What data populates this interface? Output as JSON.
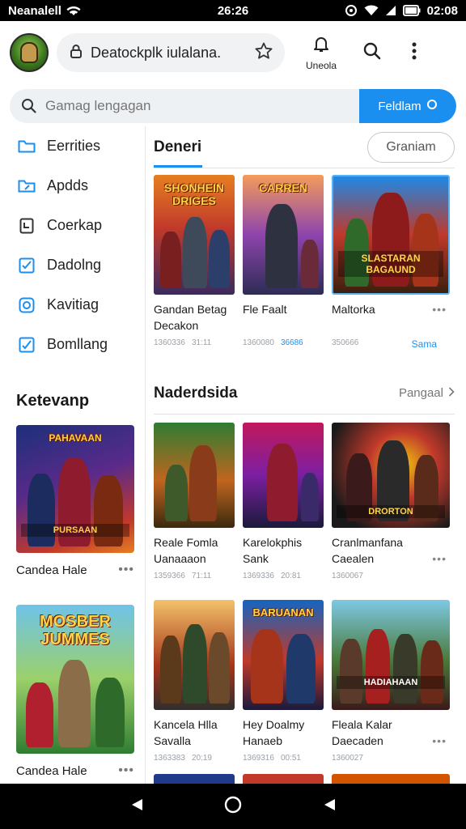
{
  "status": {
    "carrier": "Neanalell",
    "clock": "26:26",
    "time": "02:08"
  },
  "topbar": {
    "url": "Deatockplk iulalana.",
    "bell_label": "Uneola"
  },
  "search": {
    "placeholder": "Gamag lengagan",
    "button_label": "Feldlam"
  },
  "sidebar": {
    "items": [
      {
        "label": "Eerrities",
        "icon": "folder-icon"
      },
      {
        "label": "Apdds",
        "icon": "folder-edit-icon"
      },
      {
        "label": "Coerkap",
        "icon": "page-icon"
      },
      {
        "label": "Dadolng",
        "icon": "checkbox-icon"
      },
      {
        "label": "Kavitiag",
        "icon": "circle-square-icon"
      },
      {
        "label": "Bomllang",
        "icon": "check-square-icon"
      }
    ],
    "section_title": "Ketevanp",
    "cards": [
      {
        "caption": "Candea Hale",
        "art_title": "PAHAVAAN",
        "art_banner": "PURSAAN"
      },
      {
        "caption": "Candea Hale",
        "art_title": "MOSBER JUMMES",
        "art_banner": ""
      }
    ]
  },
  "main": {
    "section1": {
      "title": "Deneri",
      "action": "Graniam",
      "cards": [
        {
          "title_line1": "Gandan Betag",
          "title_line2": "Decakon",
          "meta1": "1360336",
          "meta2": "31:11",
          "art_title": "SHONHEIN DRIGES",
          "art_banner": ""
        },
        {
          "title_line1": "Fle Faalt",
          "title_line2": "",
          "meta1": "1360080",
          "meta2": "36686",
          "art_title": "CARREN",
          "art_banner": ""
        },
        {
          "title_line1": "Maltorka",
          "title_line2": "",
          "meta1": "350666",
          "meta2": "Sama",
          "art_title": "",
          "art_banner": "SLASTARAN BAGAUND"
        }
      ]
    },
    "section2": {
      "title": "Naderdsida",
      "action": "Pangaal",
      "rows": [
        [
          {
            "title_line1": "Reale Fomla",
            "title_line2": "Uanaaaon",
            "meta1": "1359366",
            "meta2": "71:11",
            "art_title": "",
            "art_banner": ""
          },
          {
            "title_line1": "Karelokphis",
            "title_line2": "Sank",
            "meta1": "1369336",
            "meta2": "20:81",
            "art_title": "",
            "art_banner": ""
          },
          {
            "title_line1": "Cranlmanfana",
            "title_line2": "Caealen",
            "meta1": "1360067",
            "meta2": "",
            "art_title": "",
            "art_banner": "DRORTON"
          }
        ],
        [
          {
            "title_line1": "Kancela Hlla",
            "title_line2": "Savalla",
            "meta1": "1363383",
            "meta2": "20:19",
            "art_title": "",
            "art_banner": ""
          },
          {
            "title_line1": "Hey Doalmy",
            "title_line2": "Hanaeb",
            "meta1": "1369316",
            "meta2": "00:51",
            "art_title": "BARUANAN",
            "art_banner": ""
          },
          {
            "title_line1": "Fleala Kalar",
            "title_line2": "Daecaden",
            "meta1": "1360027",
            "meta2": "",
            "art_title": "",
            "art_banner": "HADIAHAAN"
          }
        ]
      ]
    }
  },
  "colors": {
    "accent": "#1a8ff0",
    "statusbar": "#000000"
  }
}
